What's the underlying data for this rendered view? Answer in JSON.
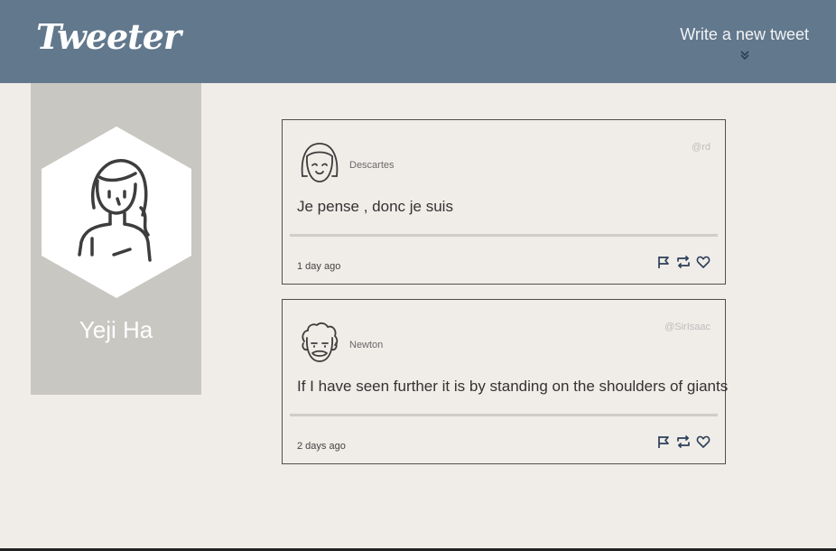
{
  "nav": {
    "brand": "Tweeter",
    "write_label": "Write a new tweet",
    "write_icon": "double-chevron-down-icon"
  },
  "profile": {
    "name": "Yeji Ha",
    "avatar_icon": "girl-avatar-icon"
  },
  "tweets": [
    {
      "author": "Descartes",
      "handle": "@rd",
      "content": "Je pense , donc je suis",
      "timestamp": "1 day ago",
      "avatar_icon": "bob-hair-avatar-icon"
    },
    {
      "author": "Newton",
      "handle": "@SirIsaac",
      "content": "If I have seen further it is by standing on the shoulders of giants",
      "timestamp": "2 days ago",
      "avatar_icon": "curly-hair-avatar-icon"
    }
  ],
  "colors": {
    "navbar": "#61788d",
    "page_background": "#f0ece8",
    "profile_panel": "#c9c7c2",
    "icon": "#2b3f58"
  }
}
